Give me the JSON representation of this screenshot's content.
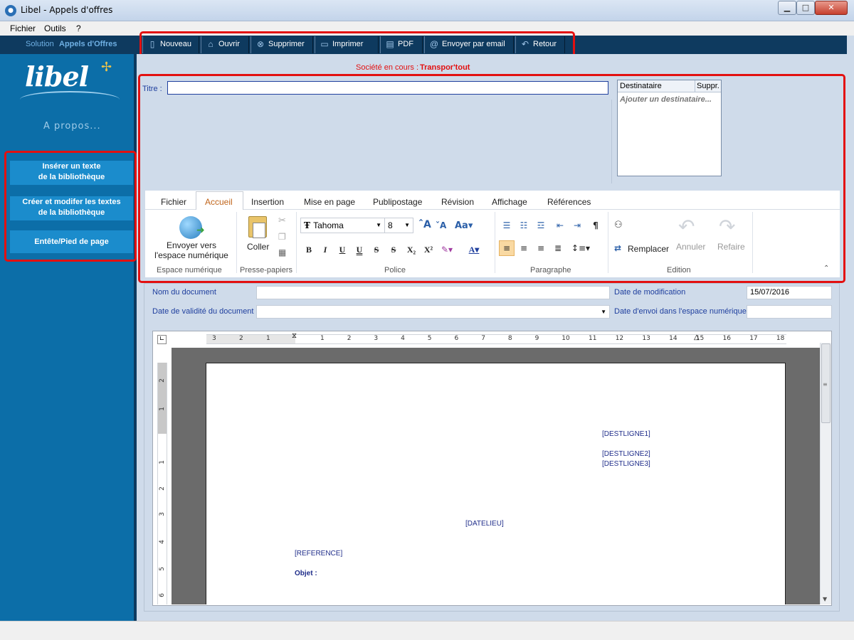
{
  "window": {
    "title": "Libel - Appels d'offres",
    "app_icon": "app-logo-icon"
  },
  "menubar": {
    "items": [
      "Fichier",
      "Outils",
      "?"
    ]
  },
  "band": {
    "solution_label": "Solution",
    "solution_name": "Appels d'Offres"
  },
  "toolbar": {
    "buttons": [
      {
        "label": "Nouveau",
        "icon": "new-document-icon"
      },
      {
        "label": "Ouvrir",
        "icon": "folder-icon"
      },
      {
        "label": "Supprimer",
        "icon": "delete-icon"
      },
      {
        "label": "Imprimer",
        "icon": "printer-icon"
      },
      {
        "label": "PDF",
        "icon": "pdf-icon"
      },
      {
        "label": "Envoyer par email",
        "icon": "at-icon"
      },
      {
        "label": "Retour",
        "icon": "back-arrow-icon"
      }
    ]
  },
  "sidebar": {
    "logo": "libel",
    "apropos": "A propos...",
    "buttons": [
      {
        "line1": "Insérer un texte",
        "line2": "de la bibliothèque"
      },
      {
        "line1": "Créer et modifer les textes",
        "line2": "de la bibliothèque"
      },
      {
        "line1": "Entête/Pied de page"
      }
    ]
  },
  "societe": {
    "label": "Société en cours :",
    "value": "Transpor'tout"
  },
  "titre": {
    "label": "Titre :",
    "value": ""
  },
  "destinataires": {
    "col1": "Destinataire",
    "col2": "Suppr.",
    "add_placeholder": "Ajouter un destinataire..."
  },
  "ribbon": {
    "tabs": [
      "Fichier",
      "Accueil",
      "Insertion",
      "Mise en page",
      "Publipostage",
      "Révision",
      "Affichage",
      "Références"
    ],
    "active_tab": "Accueil",
    "groups": {
      "espace": {
        "label": "Espace numérique",
        "button_line1": "Envoyer vers",
        "button_line2": "l'espace numérique"
      },
      "presse": {
        "label": "Presse-papiers",
        "coller": "Coller"
      },
      "police": {
        "label": "Police",
        "font": "Tahoma",
        "size": "8"
      },
      "paragraphe": {
        "label": "Paragraphe"
      },
      "edition": {
        "label": "Edition",
        "remplacer": "Remplacer",
        "annuler": "Annuler",
        "refaire": "Refaire"
      }
    }
  },
  "form": {
    "nom_label": "Nom du document",
    "nom_value": "",
    "validite_label": "Date de validité du document",
    "validite_value": "",
    "modif_label": "Date de modification",
    "modif_value": "15/07/2016",
    "envoi_label": "Date d'envoi dans l'espace numérique",
    "envoi_value": ""
  },
  "ruler": {
    "left_marks": [
      "3",
      "2",
      "1"
    ],
    "marks": [
      "1",
      "2",
      "3",
      "4",
      "5",
      "6",
      "7",
      "8",
      "9",
      "10",
      "11",
      "12",
      "13",
      "14",
      "15",
      "16",
      "17",
      "18"
    ],
    "vertical_marks": [
      "2",
      "1",
      "1",
      "2",
      "3",
      "4",
      "5",
      "6"
    ]
  },
  "document": {
    "dest1": "[DESTLIGNE1]",
    "dest2": "[DESTLIGNE2]",
    "dest3": "[DESTLIGNE3]",
    "datelieu": "[DATELIEU]",
    "reference": "[REFERENCE]",
    "objet": "Objet :"
  },
  "colors": {
    "highlight": "#e31010",
    "sidebar": "#0c6ea8",
    "band": "#0e3a5f",
    "label_blue": "#1f3f9e"
  }
}
